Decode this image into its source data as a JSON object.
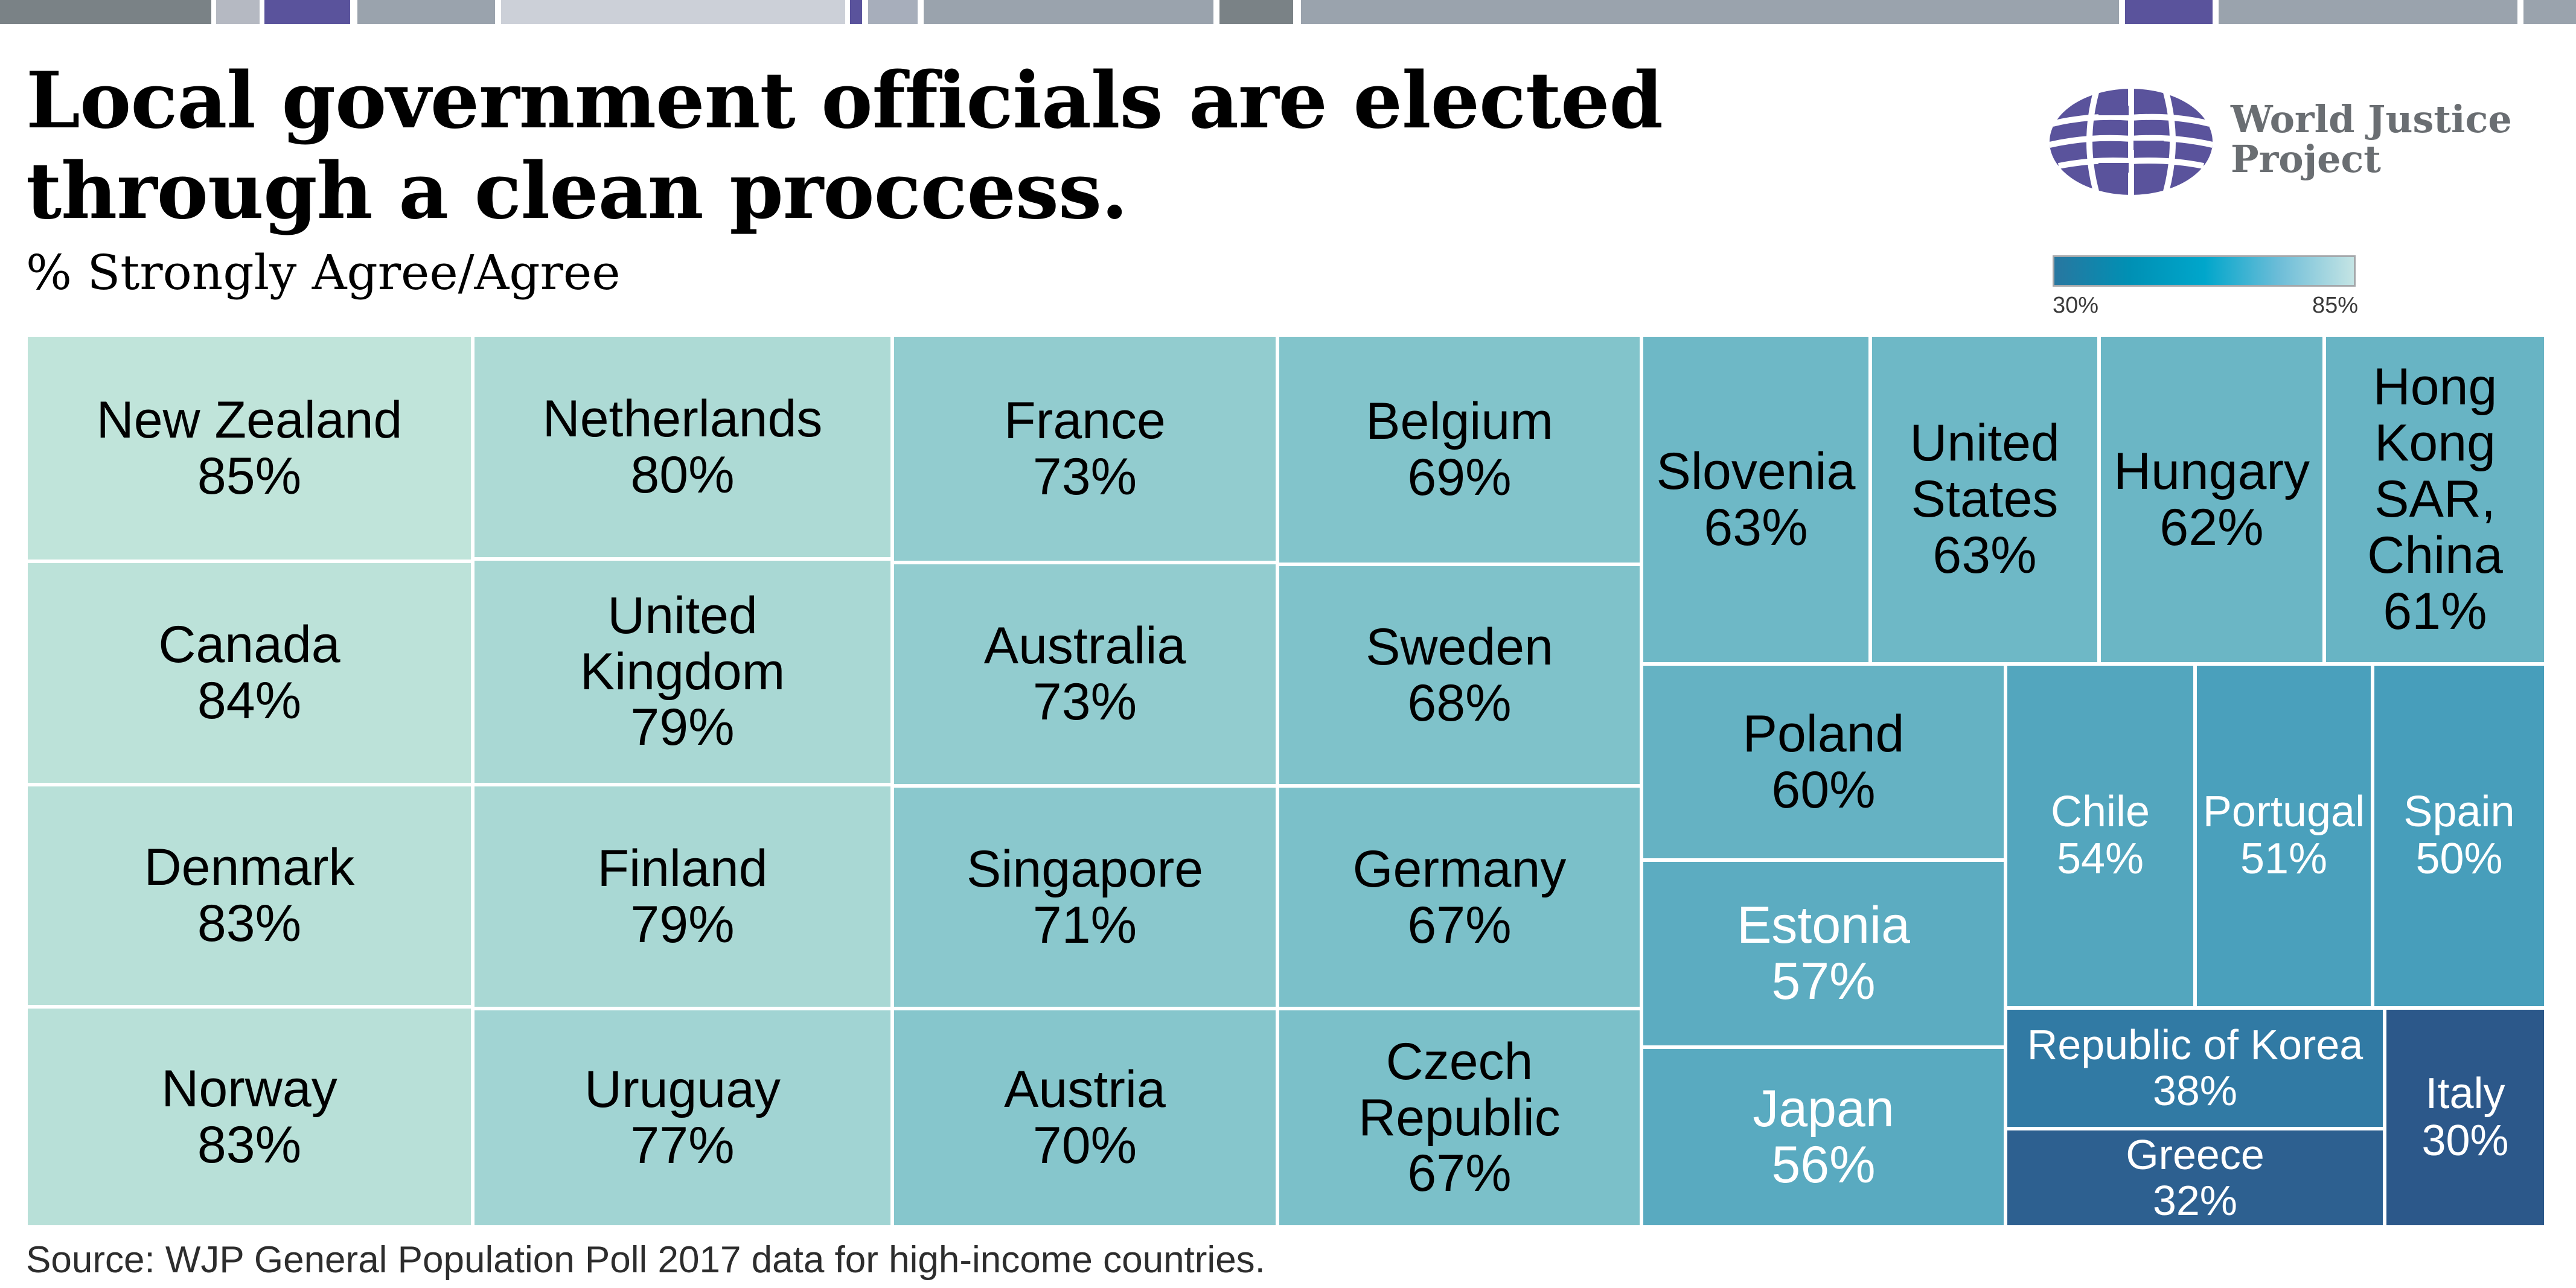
{
  "header": {
    "title_line1": "Local government officials are elected",
    "title_line2": "through a clean proccess.",
    "subtitle": "% Strongly Agree/Agree"
  },
  "logo": {
    "icon": "globe-icon",
    "line1": "World Justice",
    "line2": "Project",
    "color": "#5a539c"
  },
  "legend": {
    "min_label": "30%",
    "max_label": "85%",
    "colors": [
      "#2877a0",
      "#0090b4",
      "#00a6cb",
      "#6dbdd8",
      "#c4e4e4"
    ]
  },
  "topbar_colors": [
    "#7a8286",
    "#b5b9c2",
    "#5a539c",
    "#9aa3ad",
    "#ccd0d8",
    "#5a539c",
    "#a7aebb",
    "#9aa3ad",
    "#7a8286",
    "#9aa3ad",
    "#5a539c",
    "#9aa3ad",
    "#9aa3ad"
  ],
  "footer": {
    "source": "Source: WJP General Population Poll 2017 data for high-income countries."
  },
  "chart_data": {
    "type": "treemap",
    "title": "Local government officials are elected through a clean proccess.",
    "subtitle": "% Strongly Agree/Agree",
    "color_scale": {
      "min": 30,
      "max": 85,
      "min_label": "30%",
      "max_label": "85%"
    },
    "unit": "%",
    "items": [
      {
        "name": "New Zealand",
        "value": 85,
        "label": "85%"
      },
      {
        "name": "Canada",
        "value": 84,
        "label": "84%"
      },
      {
        "name": "Denmark",
        "value": 83,
        "label": "83%"
      },
      {
        "name": "Norway",
        "value": 83,
        "label": "83%"
      },
      {
        "name": "Netherlands",
        "value": 80,
        "label": "80%"
      },
      {
        "name": "United Kingdom",
        "value": 79,
        "label": "79%"
      },
      {
        "name": "Finland",
        "value": 79,
        "label": "79%"
      },
      {
        "name": "Uruguay",
        "value": 77,
        "label": "77%"
      },
      {
        "name": "France",
        "value": 73,
        "label": "73%"
      },
      {
        "name": "Australia",
        "value": 73,
        "label": "73%"
      },
      {
        "name": "Singapore",
        "value": 71,
        "label": "71%"
      },
      {
        "name": "Austria",
        "value": 70,
        "label": "70%"
      },
      {
        "name": "Belgium",
        "value": 69,
        "label": "69%"
      },
      {
        "name": "Sweden",
        "value": 68,
        "label": "68%"
      },
      {
        "name": "Germany",
        "value": 67,
        "label": "67%"
      },
      {
        "name": "Czech Republic",
        "value": 67,
        "label": "67%"
      },
      {
        "name": "Slovenia",
        "value": 63,
        "label": "63%"
      },
      {
        "name": "United States",
        "value": 63,
        "label": "63%"
      },
      {
        "name": "Hungary",
        "value": 62,
        "label": "62%"
      },
      {
        "name": "Hong Kong SAR, China",
        "value": 61,
        "label": "61%"
      },
      {
        "name": "Poland",
        "value": 60,
        "label": "60%"
      },
      {
        "name": "Estonia",
        "value": 57,
        "label": "57%"
      },
      {
        "name": "Japan",
        "value": 56,
        "label": "56%"
      },
      {
        "name": "Chile",
        "value": 54,
        "label": "54%"
      },
      {
        "name": "Portugal",
        "value": 51,
        "label": "51%"
      },
      {
        "name": "Spain",
        "value": 50,
        "label": "50%"
      },
      {
        "name": "Republic of Korea",
        "value": 38,
        "label": "38%"
      },
      {
        "name": "Greece",
        "value": 32,
        "label": "32%"
      },
      {
        "name": "Italy",
        "value": 30,
        "label": "30%"
      }
    ]
  }
}
